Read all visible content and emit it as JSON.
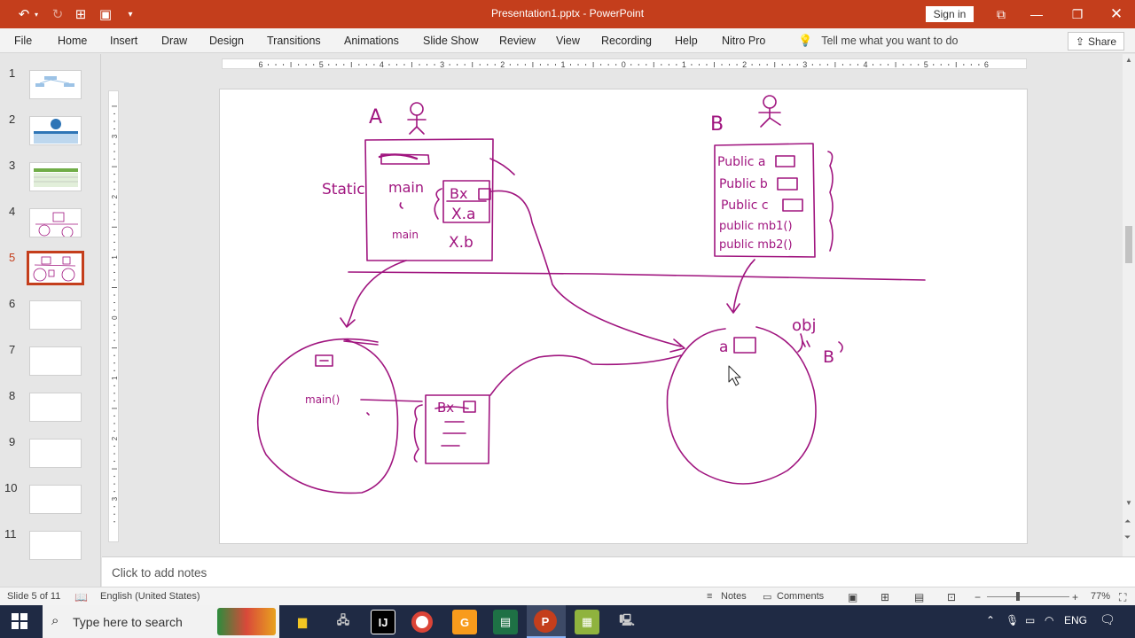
{
  "window": {
    "title": "Presentation1.pptx - PowerPoint",
    "sign_in": "Sign in"
  },
  "ribbon": {
    "tabs": [
      "File",
      "Home",
      "Insert",
      "Draw",
      "Design",
      "Transitions",
      "Animations",
      "Slide Show",
      "Review",
      "View",
      "Recording",
      "Help",
      "Nitro Pro"
    ],
    "tell_me": "Tell me what you want to do",
    "share": "Share"
  },
  "ruler": {
    "h_labels": [
      "6",
      "5",
      "4",
      "3",
      "2",
      "1",
      "0",
      "1",
      "2",
      "3",
      "4",
      "5",
      "6"
    ],
    "v_labels": [
      "3",
      "2",
      "1",
      "0",
      "1",
      "2",
      "3"
    ]
  },
  "thumbnails": {
    "numbers": [
      "1",
      "2",
      "3",
      "4",
      "5",
      "6",
      "7",
      "8",
      "9",
      "10",
      "11"
    ],
    "selected": 5
  },
  "slide": {
    "ink_color": "#a0157f",
    "labels": {
      "a": "A",
      "b": "B",
      "static_main": "Static",
      "main": "main",
      "bx": "Bx",
      "xa": "X.a",
      "xb": "X.b",
      "pub_a": "Public a",
      "pub_b": "Public b",
      "pub_c": "Public c",
      "pub_mb1": "public mb1()",
      "pub_mb2": "public mb2()",
      "main2": "main()",
      "bx2": "Bx",
      "obj": "obj",
      "b_quote": "B",
      "a_box": "a"
    }
  },
  "notes": {
    "placeholder": "Click to add notes"
  },
  "status": {
    "slide": "Slide 5 of 11",
    "language": "English (United States)",
    "notes": "Notes",
    "comments": "Comments",
    "zoom": "77%"
  },
  "taskbar": {
    "search": "Type here to search",
    "lang": "ENG"
  }
}
